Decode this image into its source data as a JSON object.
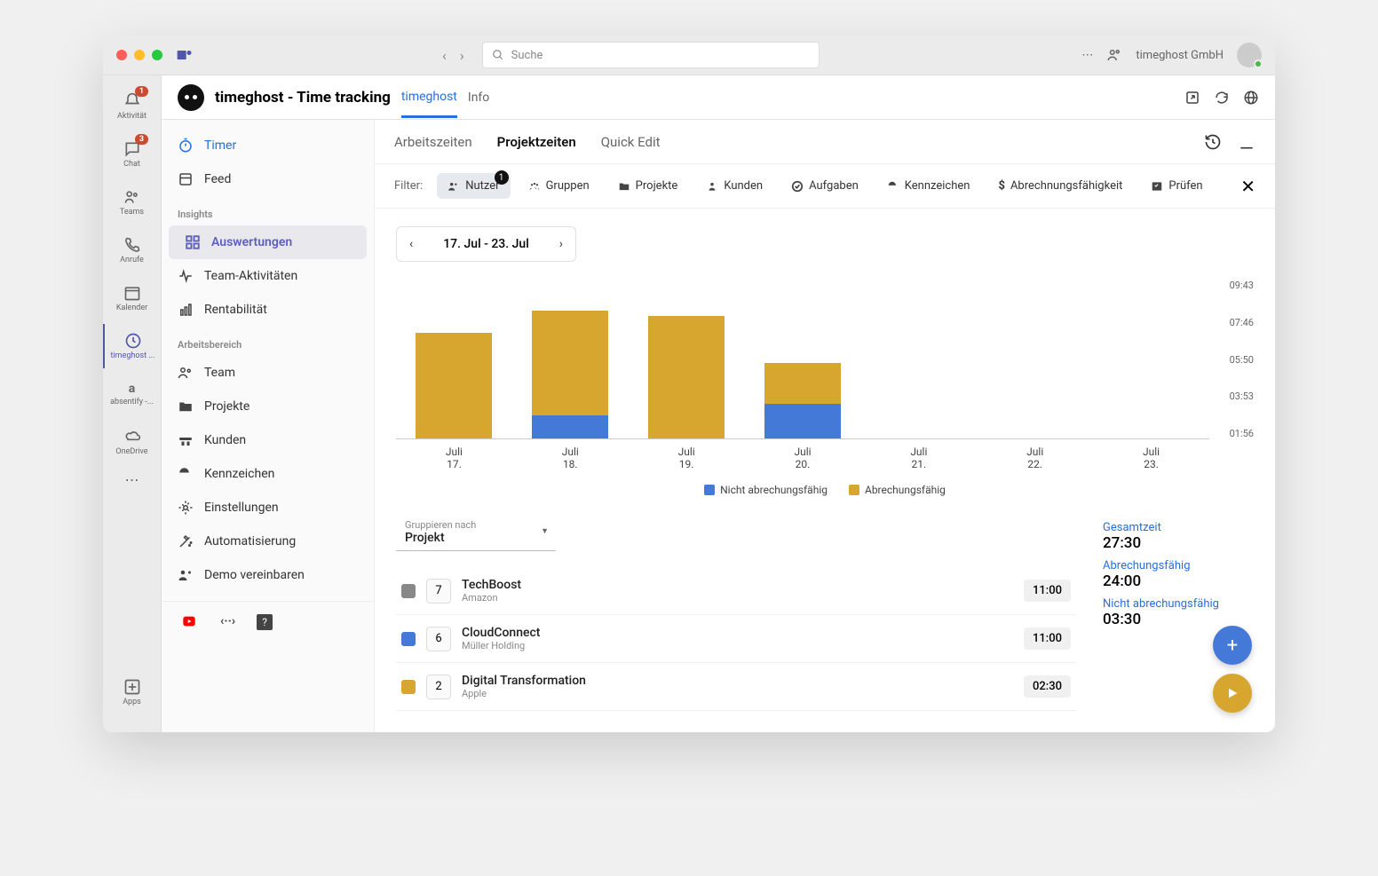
{
  "titlebar": {
    "search_placeholder": "Suche",
    "org_name": "timeghost GmbH"
  },
  "rail": {
    "items": [
      {
        "label": "Aktivität",
        "badge": "1",
        "icon": "bell"
      },
      {
        "label": "Chat",
        "badge": "3",
        "icon": "chat"
      },
      {
        "label": "Teams",
        "icon": "people"
      },
      {
        "label": "Anrufe",
        "icon": "phone"
      },
      {
        "label": "Kalender",
        "icon": "calendar"
      },
      {
        "label": "timeghost ...",
        "icon": "clock"
      },
      {
        "label": "absentify -...",
        "icon": "letter"
      },
      {
        "label": "OneDrive",
        "icon": "cloud"
      }
    ],
    "apps_label": "Apps"
  },
  "app": {
    "title": "timeghost - Time tracking",
    "tab1": "timeghost",
    "tab2": "Info"
  },
  "sidebar": {
    "timer": "Timer",
    "feed": "Feed",
    "section_insights": "Insights",
    "auswertungen": "Auswertungen",
    "team_act": "Team-Aktivitäten",
    "rent": "Rentabilität",
    "section_workspace": "Arbeitsbereich",
    "team": "Team",
    "projekte": "Projekte",
    "kunden": "Kunden",
    "kennzeichen": "Kennzeichen",
    "einstellungen": "Einstellungen",
    "automat": "Automatisierung",
    "demo": "Demo vereinbaren"
  },
  "tabs": {
    "arbeitszeiten": "Arbeitszeiten",
    "projektzeiten": "Projektzeiten",
    "quickedit": "Quick Edit"
  },
  "filter": {
    "label": "Filter:",
    "nutzer": "Nutzer",
    "nutzer_badge": "1",
    "gruppen": "Gruppen",
    "projekte": "Projekte",
    "kunden": "Kunden",
    "aufgaben": "Aufgaben",
    "kennzeichen": "Kennzeichen",
    "abrech": "Abrechnungsfähigkeit",
    "pruefen": "Prüfen"
  },
  "date_range": "17. Jul - 23. Jul",
  "chart_data": {
    "type": "bar",
    "categories": [
      "Juli 17.",
      "Juli 18.",
      "Juli 19.",
      "Juli 20.",
      "Juli 21.",
      "Juli 22.",
      "Juli 23."
    ],
    "xlabels_top": [
      "Juli",
      "Juli",
      "Juli",
      "Juli",
      "Juli",
      "Juli",
      "Juli"
    ],
    "xlabels_bottom": [
      "17.",
      "18.",
      "19.",
      "20.",
      "21.",
      "22.",
      "23."
    ],
    "series": [
      {
        "name": "Nicht abrechungsfähig",
        "values": [
          0.0,
          1.4,
          0.0,
          2.1,
          0.0,
          0.0,
          0.0
        ],
        "color": "#4579d8"
      },
      {
        "name": "Abrechungsfähig",
        "values": [
          6.4,
          6.4,
          7.45,
          2.5,
          0.0,
          0.0,
          0.0
        ],
        "color": "#d6a62e"
      }
    ],
    "ylim": [
      0,
      9.72
    ],
    "yticks": [
      "09:43",
      "07:46",
      "05:50",
      "03:53",
      "01:56"
    ],
    "legend": [
      "Nicht abrechungsfähig",
      "Abrechungsfähig"
    ]
  },
  "group_by": {
    "label": "Gruppieren nach",
    "value": "Projekt"
  },
  "rows": [
    {
      "color": "#888",
      "count": "7",
      "name": "TechBoost",
      "client": "Amazon",
      "time": "11:00"
    },
    {
      "color": "#4579d8",
      "count": "6",
      "name": "CloudConnect",
      "client": "Müller Holding",
      "time": "11:00"
    },
    {
      "color": "#d6a62e",
      "count": "2",
      "name": "Digital Transformation",
      "client": "Apple",
      "time": "02:30"
    }
  ],
  "summary": {
    "gesamt_l": "Gesamtzeit",
    "gesamt_v": "27:30",
    "bill_l": "Abrechungsfähig",
    "bill_v": "24:00",
    "nonbill_l": "Nicht abrechungsfähig",
    "nonbill_v": "03:30"
  }
}
